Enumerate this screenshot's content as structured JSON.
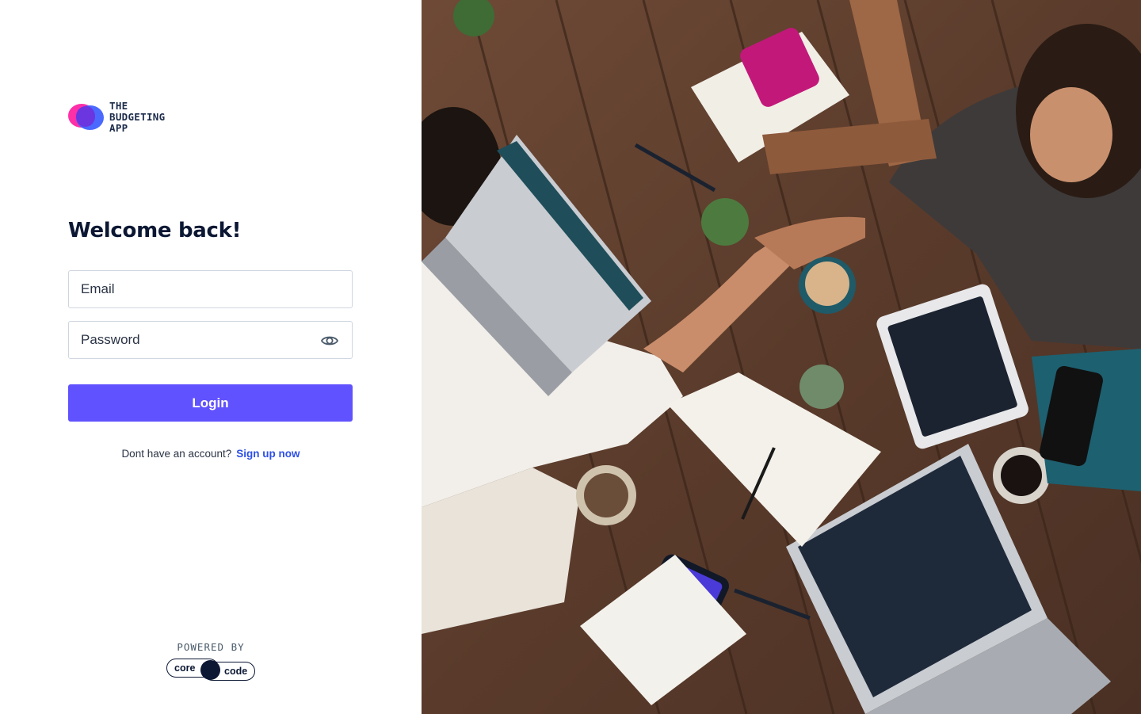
{
  "logo": {
    "line1": "THE",
    "line2": "BUDGETING",
    "line3": "APP"
  },
  "form": {
    "heading": "Welcome back!",
    "email_placeholder": "Email",
    "password_placeholder": "Password",
    "login_label": "Login",
    "signup_prompt": "Dont have an account?",
    "signup_link": "Sign up now"
  },
  "footer": {
    "powered_by": "POWERED BY",
    "brand_word1": "core",
    "brand_word2": "code"
  },
  "icons": {
    "password_toggle": "eye-icon"
  },
  "colors": {
    "primary_button": "#6152ff",
    "link": "#2d4fe6",
    "logo_pink": "#ff2fa8",
    "logo_blue": "#3c5cff",
    "heading": "#0b1733"
  }
}
